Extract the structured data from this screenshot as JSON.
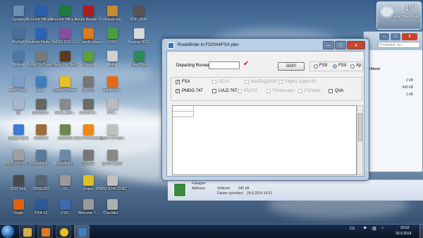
{
  "desktop": {
    "icons": [
      {
        "label": "Synaiss",
        "color": "#6b8fb3"
      },
      {
        "label": "Microsoft Office Wo...",
        "color": "#2b5fad"
      },
      {
        "label": "Microsoft Office Exc...",
        "color": "#1f7a3a"
      },
      {
        "label": "Adobe Reader XI",
        "color": "#b01c1c"
      },
      {
        "label": "Ukázat vše",
        "color": "#c98a2c"
      },
      {
        "label": "SDF_6540",
        "color": "#555555"
      },
      {
        "label": "Počítač",
        "color": "#4a6f9a"
      },
      {
        "label": "Windows Media Player",
        "color": "#2a62b8"
      },
      {
        "label": "FSX FSC...",
        "color": "#8a4ea0"
      },
      {
        "label": "VLC media player",
        "color": "#e07b15"
      },
      {
        "label": "GSQ",
        "color": "#49a040"
      },
      {
        "label": "Backup RDC",
        "color": "#d9d9d9"
      },
      {
        "label": "Sítěové",
        "color": "#4e78a8"
      },
      {
        "label": "DoNotTry Sysinfo",
        "color": "#7a7a7a"
      },
      {
        "label": "Chess Pro Start2",
        "color": "#5c3b1e"
      },
      {
        "label": "uTorrent",
        "color": "#5fa03a"
      },
      {
        "label": "flight",
        "color": "#cfcfcf"
      },
      {
        "label": "LibreOffice",
        "color": "#2e8b57"
      },
      {
        "label": "Ecla ...",
        "color": "#3f7fbf"
      },
      {
        "label": "Google Chrome",
        "color": "#e8c020"
      },
      {
        "label": "LPR3718",
        "color": "#777777"
      },
      {
        "label": "avast! free...",
        "color": "#e86a10"
      },
      {
        "label": "flight Vista...",
        "color": "#7a9fc8"
      },
      {
        "label": "Koš",
        "color": "#a9b8c8"
      },
      {
        "label": "S5601900...",
        "color": "#666666"
      },
      {
        "label": "Nnow_ejkm...",
        "color": "#8a8a8a"
      },
      {
        "label": "S2451046...",
        "color": "#6b6b6b"
      },
      {
        "label": "FPS-...",
        "color": "#bbbbbb"
      },
      {
        "label": "Google Earth",
        "color": "#3a7bd5"
      },
      {
        "label": "79651501",
        "color": "#9b6b3a"
      },
      {
        "label": "13483992",
        "color": "#6a8a4a"
      },
      {
        "label": "avast! Free Antivirus",
        "color": "#f08a10"
      },
      {
        "label": "PMDG 737-800...",
        "color": "#c0c0c0"
      },
      {
        "label": "PMDG 747-400 F...",
        "color": "#a0a0a0"
      },
      {
        "label": "mount-eve...",
        "color": "#5a7a9a"
      },
      {
        "label": "MountRain...",
        "color": "#6a8aa8"
      },
      {
        "label": "1793107",
        "color": "#777777"
      },
      {
        "label": "pic737-studio",
        "color": "#888888"
      },
      {
        "label": "DS3 Tool",
        "color": "#4a4a4a"
      },
      {
        "label": "50360182",
        "color": "#556677"
      },
      {
        "label": "03",
        "color": "#999999"
      },
      {
        "label": "Fraps",
        "color": "#e0c020"
      },
      {
        "label": "PMDG B744 CHECKLIST",
        "color": "#c0c0c0"
      },
      {
        "label": "Origin",
        "color": "#e06010"
      },
      {
        "label": "FIFA 13",
        "color": "#2a5a9a"
      },
      {
        "label": "FSX",
        "color": "#3a6ab0"
      },
      {
        "label": "Welcome T...",
        "color": "#9a9a9a"
      },
      {
        "label": "Checklist...",
        "color": "#b0b0b0"
      }
    ]
  },
  "weather_gadget": {
    "temperature": "19°",
    "location": "Praha, Hlav...Kraj"
  },
  "explorer_window": {
    "search_placeholder": "Prohledat: do...",
    "rows": [
      {
        "label": "Velikost",
        "value": ""
      },
      {
        "label": "",
        "value": "2 kB"
      },
      {
        "label": "",
        "value": "942 kB"
      },
      {
        "label": "",
        "value": "1 kB"
      }
    ],
    "details": {
      "name": "Fatiagne",
      "type": "Aplikace",
      "size_label": "Velikost:",
      "size": "942 kB",
      "created_label": "Datum vytvoření:",
      "created": "29.9.2014 14:21"
    }
  },
  "app_window": {
    "title": "Routefinder to FS2004/FSX  plan",
    "min_symbol": "–",
    "max_symbol": "□",
    "close_symbol": "x",
    "departing_runway_label": "Departing Runway",
    "departing_runway_value": "",
    "go_button": "GO!!!",
    "sim_radios": [
      {
        "label": "FS9",
        "selected": false
      },
      {
        "label": "FSX",
        "selected": true
      },
      {
        "label": "Xp",
        "selected": false
      }
    ],
    "row1_checks": [
      {
        "label": "FSX",
        "checked": true,
        "enabled": true
      },
      {
        "label": "DC10",
        "checked": false,
        "enabled": false
      },
      {
        "label": "MadDog2008",
        "checked": false,
        "enabled": false
      },
      {
        "label": "Flight1 Super 80",
        "checked": false,
        "enabled": false
      }
    ],
    "row2_checks": [
      {
        "label": "PMDG 747",
        "checked": true,
        "enabled": true
      },
      {
        "label": "LVLD 767",
        "checked": false,
        "enabled": true
      },
      {
        "label": "iFly737",
        "checked": false,
        "enabled": false
      },
      {
        "label": "F1Hercules",
        "checked": false,
        "enabled": false
      },
      {
        "label": "F1Plane",
        "checked": false,
        "enabled": false
      },
      {
        "label": "QVA",
        "checked": false,
        "enabled": true
      }
    ]
  },
  "taskbar": {
    "buttons": [
      {
        "name": "explorer",
        "color": "#d8b04a"
      },
      {
        "name": "media",
        "color": "#e07a20"
      },
      {
        "name": "chrome",
        "color": "#e8c020"
      },
      {
        "name": "routefinder",
        "color": "#3f7fbf"
      }
    ],
    "language": "CS",
    "time": "20:52",
    "date": "29.9.2014"
  }
}
